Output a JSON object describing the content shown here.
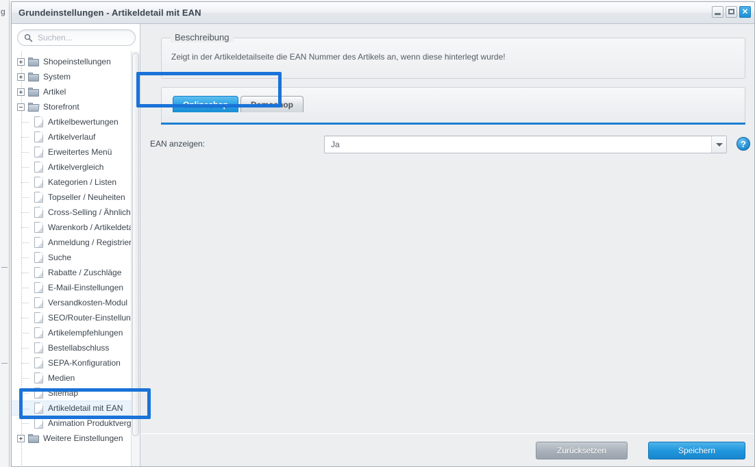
{
  "window": {
    "title": "Grundeinstellungen - Artikeldetail mit EAN",
    "controls": {
      "minimize": "−",
      "maximize": "□",
      "close": "✕"
    }
  },
  "sidebar": {
    "search": {
      "placeholder": "Suchen...",
      "value": "",
      "icon": "search-icon"
    },
    "tree": [
      {
        "label": "Shopeinstellungen",
        "level": "root",
        "state": "collapsed",
        "icon": "folder-icon"
      },
      {
        "label": "System",
        "level": "root",
        "state": "collapsed",
        "icon": "folder-icon"
      },
      {
        "label": "Artikel",
        "level": "root",
        "state": "collapsed",
        "icon": "folder-icon"
      },
      {
        "label": "Storefront",
        "level": "root",
        "state": "expanded",
        "icon": "folder-open-icon"
      },
      {
        "label": "Artikelbewertungen",
        "level": "child",
        "icon": "document-icon"
      },
      {
        "label": "Artikelverlauf",
        "level": "child",
        "icon": "document-icon"
      },
      {
        "label": "Erweitertes Menü",
        "level": "child",
        "icon": "document-icon"
      },
      {
        "label": "Artikelvergleich",
        "level": "child",
        "icon": "document-icon"
      },
      {
        "label": "Kategorien / Listen",
        "level": "child",
        "icon": "document-icon"
      },
      {
        "label": "Topseller / Neuheiten",
        "level": "child",
        "icon": "document-icon"
      },
      {
        "label": "Cross-Selling / Ähnliche Art.",
        "level": "child",
        "icon": "document-icon"
      },
      {
        "label": "Warenkorb / Artikeldetails",
        "level": "child",
        "icon": "document-icon"
      },
      {
        "label": "Anmeldung / Registrierung",
        "level": "child",
        "icon": "document-icon"
      },
      {
        "label": "Suche",
        "level": "child",
        "icon": "document-icon"
      },
      {
        "label": "Rabatte / Zuschläge",
        "level": "child",
        "icon": "document-icon"
      },
      {
        "label": "E-Mail-Einstellungen",
        "level": "child",
        "icon": "document-icon"
      },
      {
        "label": "Versandkosten-Modul",
        "level": "child",
        "icon": "document-icon"
      },
      {
        "label": "SEO/Router-Einstellungen",
        "level": "child",
        "icon": "document-icon"
      },
      {
        "label": "Artikelempfehlungen",
        "level": "child",
        "icon": "document-icon"
      },
      {
        "label": "Bestellabschluss",
        "level": "child",
        "icon": "document-icon"
      },
      {
        "label": "SEPA-Konfiguration",
        "level": "child",
        "icon": "document-icon"
      },
      {
        "label": "Medien",
        "level": "child",
        "icon": "document-icon"
      },
      {
        "label": "Sitemap",
        "level": "child",
        "icon": "document-icon"
      },
      {
        "label": "Artikeldetail mit EAN",
        "level": "child",
        "icon": "document-icon",
        "selected": true
      },
      {
        "label": "Animation Produktvergleich",
        "level": "child",
        "icon": "document-icon"
      },
      {
        "label": "Weitere Einstellungen",
        "level": "root",
        "state": "collapsed",
        "icon": "folder-icon"
      }
    ]
  },
  "main": {
    "description": {
      "legend": "Beschreibung",
      "text": "Zeigt in der Artikeldetailseite die EAN Nummer des Artikels an, wenn diese hinterlegt wurde!"
    },
    "tabs": [
      {
        "label": "Onlineshop",
        "active": true
      },
      {
        "label": "Demoshop",
        "active": false
      }
    ],
    "form": {
      "label": "EAN anzeigen:",
      "value": "Ja",
      "help_icon": "question-mark-icon",
      "help_glyph": "?"
    },
    "footer": {
      "reset_label": "Zurücksetzen",
      "save_label": "Speichern"
    }
  },
  "annotations": {
    "color": "#1a73d8",
    "targets": [
      "shop-tabs",
      "sidebar-item-artikeldetail-mit-ean"
    ]
  }
}
